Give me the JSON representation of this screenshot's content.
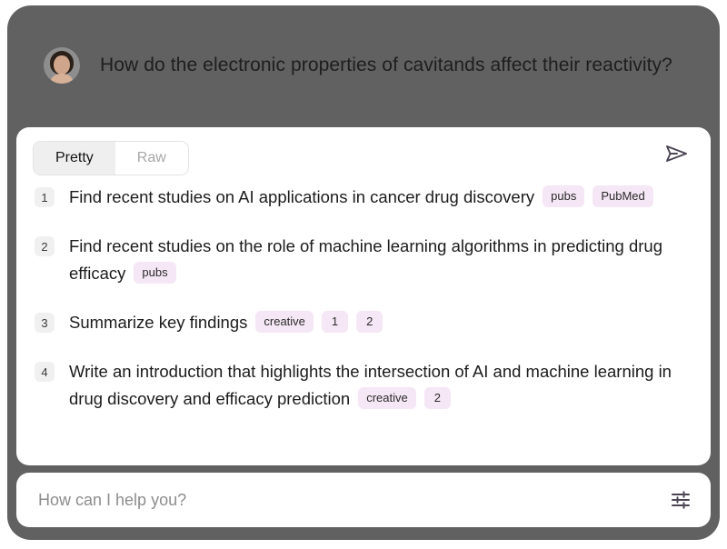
{
  "shell": {
    "background_color": "#616161",
    "card_background_color": "#ffffff",
    "badge_color": "#f5e7f5",
    "accent_text_color": "#1c1c1c"
  },
  "question": {
    "avatar_alt": "user-avatar",
    "text": "How do the electronic properties of cavitands affect their reactivity?"
  },
  "card": {
    "tabs": [
      {
        "label": "Pretty",
        "active": true
      },
      {
        "label": "Raw",
        "active": false
      }
    ],
    "send_icon": "send-icon"
  },
  "suggestions": [
    {
      "index": "1",
      "text": "Find recent studies on AI applications in cancer drug discovery",
      "badges": [
        "pubs",
        "PubMed"
      ]
    },
    {
      "index": "2",
      "text": "Find recent studies on the role of machine learning algorithms in predicting drug efficacy",
      "badges": [
        "pubs"
      ]
    },
    {
      "index": "3",
      "text": "Summarize key findings",
      "badges": [
        "creative",
        "1",
        "2"
      ]
    },
    {
      "index": "4",
      "text": "Write an introduction that highlights the intersection of AI and machine learning in drug discovery and efficacy prediction",
      "badges": [
        "creative",
        "2"
      ]
    }
  ],
  "chat_input": {
    "value": "",
    "placeholder": "How can I help you?",
    "settings_icon": "sliders-icon"
  }
}
